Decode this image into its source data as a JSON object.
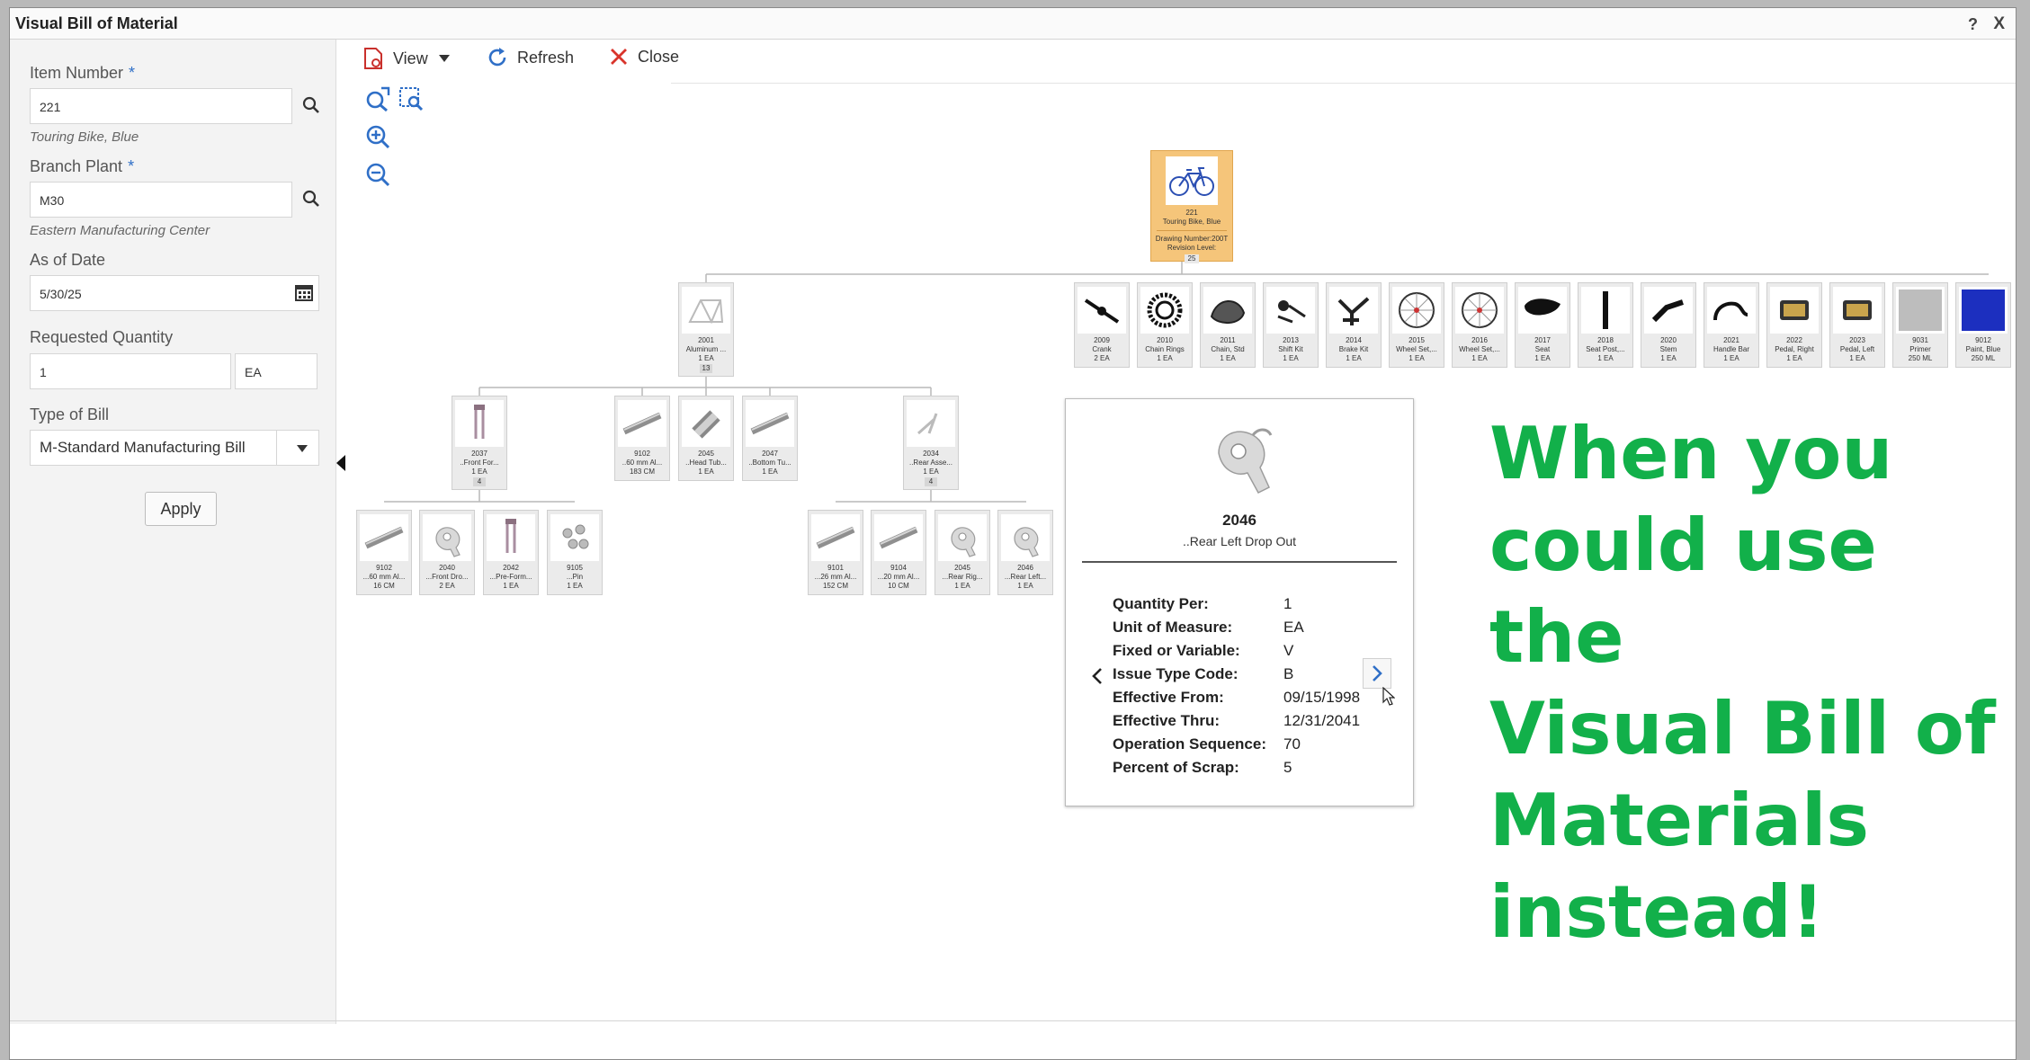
{
  "window": {
    "title": "Visual Bill of Material",
    "help": "?",
    "close": "X"
  },
  "filters": {
    "item_number": {
      "label": "Item Number",
      "required": "*",
      "value": "221",
      "description": "Touring Bike, Blue"
    },
    "branch_plant": {
      "label": "Branch Plant",
      "required": "*",
      "value": "M30",
      "description": "Eastern Manufacturing Center"
    },
    "as_of_date": {
      "label": "As of Date",
      "value": "5/30/25"
    },
    "requested_quantity": {
      "label": "Requested Quantity",
      "value": "1",
      "uom": "EA"
    },
    "type_of_bill": {
      "label": "Type of Bill",
      "value": "M-Standard Manufacturing Bill"
    },
    "apply": "Apply"
  },
  "toolbar": {
    "view": "View",
    "refresh": "Refresh",
    "close": "Close"
  },
  "root": {
    "num": "221",
    "name": "Touring Bike, Blue",
    "drawing": "Drawing Number:200T",
    "revision": "Revision Level:",
    "count": "25"
  },
  "level1": [
    {
      "num": "2001",
      "name": "Aluminum ...",
      "qty": "1 EA",
      "badge": "13",
      "icon": "frame"
    },
    {
      "num": "2009",
      "name": "Crank",
      "qty": "2 EA",
      "icon": "crank"
    },
    {
      "num": "2010",
      "name": "Chain Rings",
      "qty": "1 EA",
      "icon": "chainring"
    },
    {
      "num": "2011",
      "name": "Chain, Std",
      "qty": "1 EA",
      "icon": "chain"
    },
    {
      "num": "2013",
      "name": "Shift Kit",
      "qty": "1 EA",
      "icon": "shift"
    },
    {
      "num": "2014",
      "name": "Brake Kit",
      "qty": "1 EA",
      "icon": "brake"
    },
    {
      "num": "2015",
      "name": "Wheel Set,...",
      "qty": "1 EA",
      "icon": "wheel"
    },
    {
      "num": "2016",
      "name": "Wheel Set,...",
      "qty": "1 EA",
      "icon": "wheel"
    },
    {
      "num": "2017",
      "name": "Seat",
      "qty": "1 EA",
      "icon": "seat"
    },
    {
      "num": "2018",
      "name": "Seat Post,...",
      "qty": "1 EA",
      "icon": "post"
    },
    {
      "num": "2020",
      "name": "Stem",
      "qty": "1 EA",
      "icon": "stem"
    },
    {
      "num": "2021",
      "name": "Handle Bar",
      "qty": "1 EA",
      "icon": "bar"
    },
    {
      "num": "2022",
      "name": "Pedal, Right",
      "qty": "1 EA",
      "icon": "pedal"
    },
    {
      "num": "2023",
      "name": "Pedal, Left",
      "qty": "1 EA",
      "icon": "pedal"
    },
    {
      "num": "9031",
      "name": "Primer",
      "qty": "250 ML",
      "icon": "primer"
    },
    {
      "num": "9012",
      "name": "Paint, Blue",
      "qty": "250 ML",
      "icon": "paint"
    }
  ],
  "level2": [
    {
      "num": "2037",
      "name": "..Front For...",
      "qty": "1 EA",
      "badge": "4",
      "icon": "fork"
    },
    {
      "num": "9102",
      "name": "..60 mm Al...",
      "qty": "183 CM",
      "icon": "tube"
    },
    {
      "num": "2045",
      "name": "..Head Tub...",
      "qty": "1 EA",
      "icon": "headtube"
    },
    {
      "num": "2047",
      "name": "..Bottom Tu...",
      "qty": "1 EA",
      "icon": "tube"
    },
    {
      "num": "2034",
      "name": "..Rear Asse...",
      "qty": "1 EA",
      "badge": "4",
      "icon": "rear"
    }
  ],
  "level3": [
    {
      "num": "9102",
      "name": "...60 mm Al...",
      "qty": "16 CM",
      "icon": "tube"
    },
    {
      "num": "2040",
      "name": "...Front Dro...",
      "qty": "2 EA",
      "icon": "dropout"
    },
    {
      "num": "2042",
      "name": "...Pre-Form...",
      "qty": "1 EA",
      "icon": "fork"
    },
    {
      "num": "9105",
      "name": "...Pin",
      "qty": "1 EA",
      "icon": "pin"
    },
    {
      "num": "9101",
      "name": "...26 mm Al...",
      "qty": "152 CM",
      "icon": "tube"
    },
    {
      "num": "9104",
      "name": "...20 mm Al...",
      "qty": "10 CM",
      "icon": "tube"
    },
    {
      "num": "2045",
      "name": "...Rear Rig...",
      "qty": "1 EA",
      "icon": "dropout"
    },
    {
      "num": "2046",
      "name": "...Rear Left...",
      "qty": "1 EA",
      "icon": "dropout"
    }
  ],
  "popup": {
    "num": "2046",
    "name": "..Rear Left Drop Out",
    "rows": [
      {
        "k": "Quantity Per:",
        "v": "1"
      },
      {
        "k": "Unit of Measure:",
        "v": "EA"
      },
      {
        "k": "Fixed or Variable:",
        "v": "V"
      },
      {
        "k": "Issue Type Code:",
        "v": "B"
      },
      {
        "k": "Effective From:",
        "v": "09/15/1998"
      },
      {
        "k": "Effective Thru:",
        "v": "12/31/2041"
      },
      {
        "k": "Operation Sequence:",
        "v": "70"
      },
      {
        "k": "Percent of Scrap:",
        "v": "5"
      }
    ]
  },
  "overlay": [
    "When you",
    "could use the",
    "Visual Bill of",
    "Materials",
    "instead!"
  ],
  "colors": {
    "accent_green": "#12b04a",
    "root_fill": "#f5c57a",
    "icon_blue": "#2f6fc7"
  }
}
